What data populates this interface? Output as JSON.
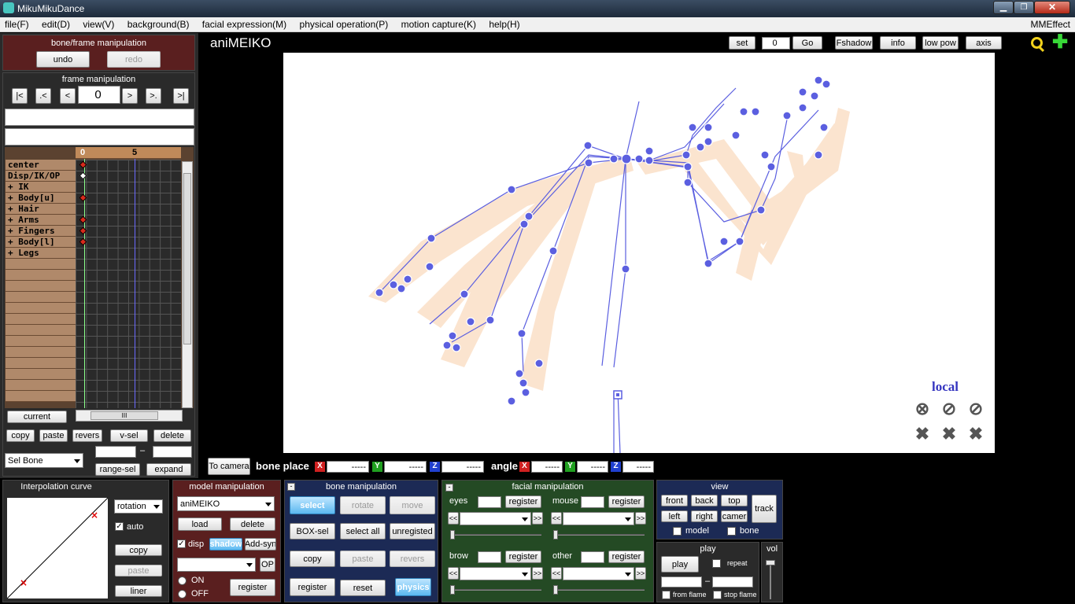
{
  "window": {
    "title": "MikuMikuDance"
  },
  "menu": {
    "items": [
      "file(F)",
      "edit(D)",
      "view(V)",
      "background(B)",
      "facial expression(M)",
      "physical operation(P)",
      "motion capture(K)",
      "help(H)"
    ],
    "right": "MMEffect"
  },
  "bone_frame": {
    "title": "bone/frame manipulation",
    "undo": "undo",
    "redo": "redo"
  },
  "frame_manip": {
    "title": "frame manipulation",
    "nav": [
      "|<",
      ".<",
      "<",
      ">",
      ">.",
      ">|"
    ],
    "frame_value": "0"
  },
  "timeline": {
    "ruler": [
      "0",
      "5"
    ],
    "rows": [
      "center",
      "Disp/IK/OP",
      "+ IK",
      "+ Body[u]",
      "+ Hair",
      "+ Arms",
      "+ Fingers",
      "+ Body[l]",
      "+ Legs"
    ]
  },
  "frame_buttons": {
    "current": "current",
    "copy": "copy",
    "paste": "paste",
    "revers": "revers",
    "vsel": "v-sel",
    "delete": "delete",
    "selbone": "Sel Bone",
    "dash": "–",
    "rangesel": "range-sel",
    "expand": "expand"
  },
  "viewport": {
    "model_name": "aniMEIKO",
    "set": "set",
    "frame_input": "0",
    "go": "Go",
    "fshadow": "Fshadow",
    "info": "info",
    "lowpow": "low pow",
    "axis": "axis",
    "local": "local"
  },
  "coords": {
    "to_camera": "To camera",
    "bone_place": "bone place",
    "angle": "angle",
    "x": "X",
    "y": "Y",
    "z": "Z",
    "empty": "-----"
  },
  "interp": {
    "title": "Interpolation curve",
    "mode": "rotation",
    "auto": "auto",
    "copy": "copy",
    "paste": "paste",
    "liner": "liner"
  },
  "model_manip": {
    "title": "model manipulation",
    "model": "aniMEIKO",
    "load": "load",
    "delete": "delete",
    "disp": "disp",
    "shadow": "shadow",
    "addsyn": "Add-syn",
    "op": "OP",
    "on": "ON",
    "off": "OFF",
    "register": "register"
  },
  "bone_manip": {
    "title": "bone manipulation",
    "select": "select",
    "rotate": "rotate",
    "move": "move",
    "boxsel": "BOX-sel",
    "selectall": "select all",
    "unregisted": "unregisted",
    "copy": "copy",
    "paste": "paste",
    "revers": "revers",
    "register": "register",
    "reset": "reset",
    "physics": "physics"
  },
  "facial": {
    "title": "facial manipulation",
    "eyes": "eyes",
    "mouse": "mouse",
    "brow": "brow",
    "other": "other",
    "register": "register",
    "prev": "<<",
    "next": ">>"
  },
  "view": {
    "title": "view",
    "front": "front",
    "back": "back",
    "top": "top",
    "track": "track",
    "left": "left",
    "right": "right",
    "camer": "camer",
    "model": "model",
    "bone": "bone"
  },
  "play": {
    "title": "play",
    "play": "play",
    "repeat": "repeat",
    "dash": "–",
    "from": "from flame",
    "stop": "stop flame"
  },
  "vol": {
    "title": "vol"
  },
  "colors": {
    "accent": "#5bb8f0",
    "bone": "#5b5fe0",
    "panel_red": "#5a1f1f",
    "panel_green": "#244a24",
    "panel_blue": "#1c2a55"
  }
}
